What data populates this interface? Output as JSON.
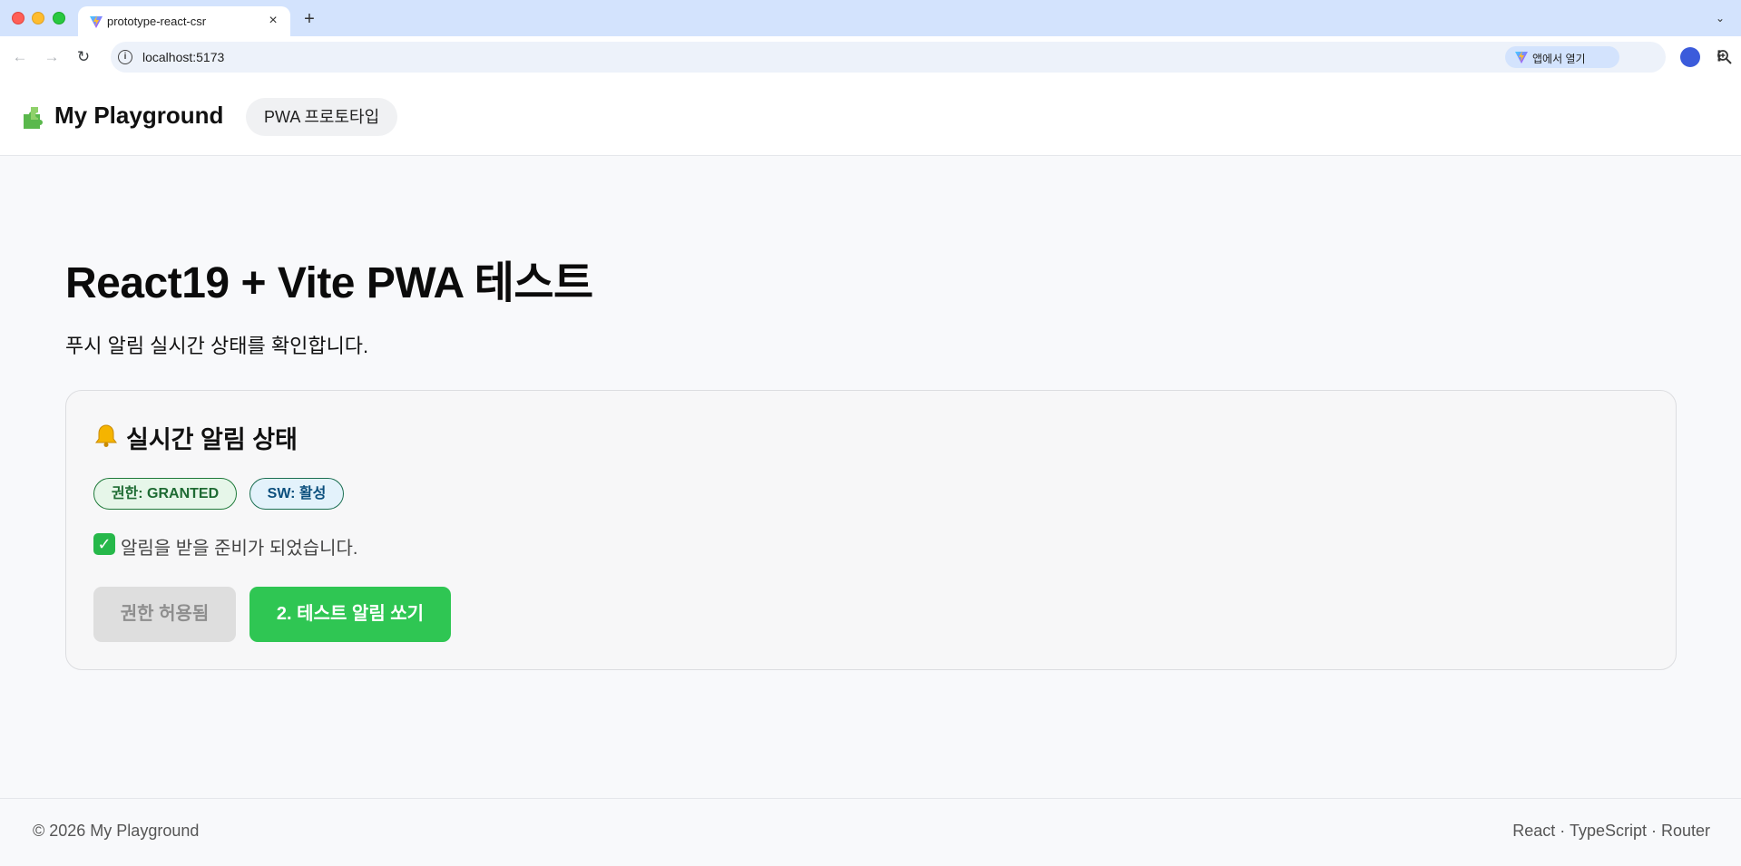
{
  "browser": {
    "tab_title": "prototype-react-csr",
    "tab_close": "×",
    "new_tab": "+",
    "tab_menu": "⌄",
    "url": "localhost:5173",
    "open_app_label": "앱에서 열기",
    "icons": {
      "back": "arrow-left-icon",
      "forward": "arrow-right-icon",
      "reload": "reload-icon",
      "info": "info-icon",
      "zoom": "zoom-in-icon",
      "bookmark": "star-icon",
      "profile": "profile-icon",
      "menu": "kebab-icon"
    }
  },
  "header": {
    "brand_title": "My Playground",
    "brand_icon": "puzzle-icon",
    "nav_pill": "PWA 프로토타입"
  },
  "main": {
    "title": "React19 + Vite PWA 테스트",
    "description": "푸시 알림 실시간 상태를 확인합니다."
  },
  "card": {
    "icon": "bell-icon",
    "title": "실시간 알림 상태",
    "badge_permission": "권한: GRANTED",
    "badge_sw": "SW: 활성",
    "ready_icon": "checkmark-icon",
    "ready_text": "알림을 받을 준비가 되었습니다.",
    "btn_granted": "권한 허용됨",
    "btn_test": "2. 테스트 알림 쏘기"
  },
  "footer": {
    "copyright": "© 2026 My Playground",
    "stack": "React · TypeScript · Router"
  },
  "colors": {
    "accent_green": "#2fc653",
    "badge_green_bg": "#e6f6e9",
    "badge_blue_bg": "#e3f2fb",
    "tab_strip": "#d3e3fd"
  }
}
